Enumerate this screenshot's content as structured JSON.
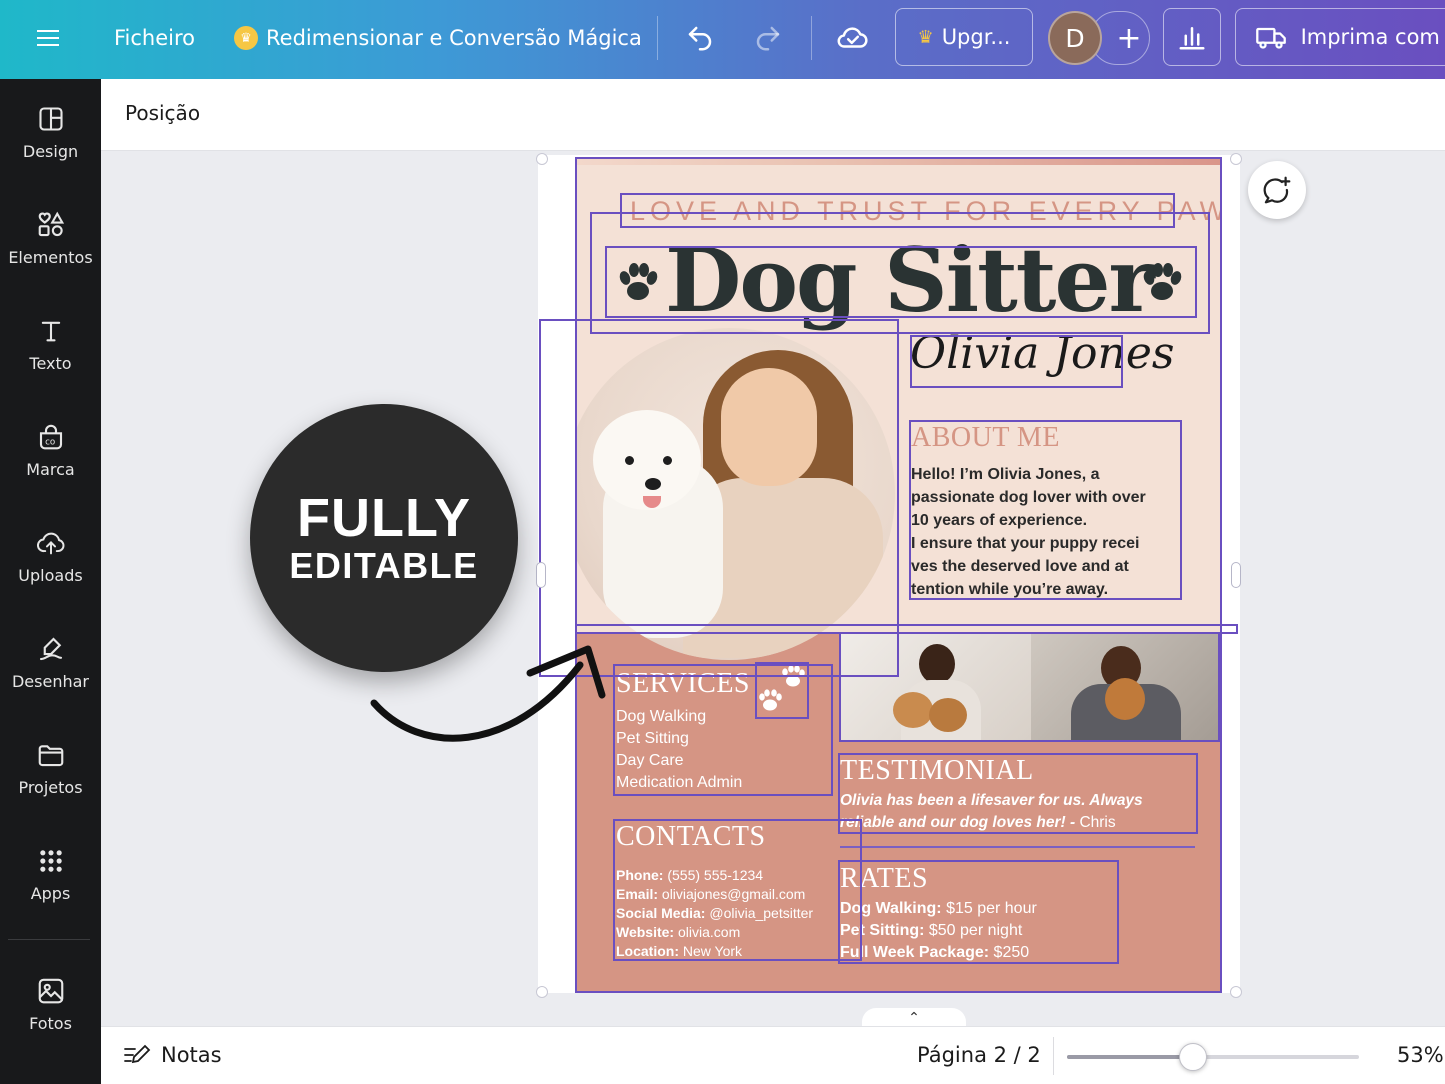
{
  "topbar": {
    "file_label": "Ficheiro",
    "magic_label": "Redimensionar e Conversão Mágica",
    "upgrade_label": "Upgr...",
    "avatar_initial": "D",
    "print_label": "Imprima com o",
    "icons": [
      "menu-icon",
      "crown-icon",
      "undo-icon",
      "redo-icon",
      "cloud-check-icon",
      "crown-icon",
      "plus-icon",
      "bar-chart-icon",
      "truck-icon"
    ]
  },
  "sidebar": {
    "items": [
      {
        "label": "Design",
        "icon": "layout-icon"
      },
      {
        "label": "Elementos",
        "icon": "shapes-icon"
      },
      {
        "label": "Texto",
        "icon": "text-icon"
      },
      {
        "label": "Marca",
        "icon": "brand-icon"
      },
      {
        "label": "Uploads",
        "icon": "cloud-upload-icon"
      },
      {
        "label": "Desenhar",
        "icon": "draw-icon"
      },
      {
        "label": "Projetos",
        "icon": "folder-icon"
      },
      {
        "label": "Apps",
        "icon": "apps-grid-icon"
      },
      {
        "label": "Fotos",
        "icon": "photo-icon"
      }
    ]
  },
  "context_bar": {
    "position_label": "Posição"
  },
  "design": {
    "tagline": "LOVE AND TRUST FOR EVERY PAW",
    "title": "Dog Sitter",
    "name": "Olivia Jones",
    "about_heading": "ABOUT ME",
    "about_lines": [
      "Hello! I’m Olivia Jones, a",
      "passionate dog lover with over",
      "10 years of experience.",
      "I ensure that your puppy recei",
      "ves the deserved love and at",
      "tention while you’re away."
    ],
    "services_heading": "SERVICES",
    "services": [
      "Dog Walking",
      "Pet Sitting",
      "Day Care",
      "Medication Admin"
    ],
    "testimonial_heading": "TESTIMONIAL",
    "testimonial_quote_1": "Olivia has been a lifesaver for us. Always",
    "testimonial_quote_2": "reliable and our dog loves her! - ",
    "testimonial_author": "Chris",
    "contacts_heading": "CONTACTS",
    "contacts": [
      {
        "label": "Phone:",
        "value": " (555) 555-1234"
      },
      {
        "label": "Email:",
        "value": " oliviajones@gmail.com"
      },
      {
        "label": "Social Media:",
        "value": " @olivia_petsitter"
      },
      {
        "label": "Website:",
        "value": " olivia.com"
      },
      {
        "label": "Location:",
        "value": " New York"
      }
    ],
    "rates_heading": "RATES",
    "rates": [
      {
        "label": "Dog Walking:",
        "value": " $15 per hour"
      },
      {
        "label": "Pet Sitting:",
        "value": " $50 per night"
      },
      {
        "label": "Full Week Package:",
        "value": " $250"
      }
    ],
    "colors": {
      "background": "#f4e1d6",
      "accent": "#d59584",
      "title": "#2a3333",
      "selection": "#6a4fc0"
    }
  },
  "badge": {
    "line1": "FULLY",
    "line2": "EDITABLE"
  },
  "bottombar": {
    "notes_label": "Notas",
    "page_indicator": "Página 2 / 2",
    "zoom_label": "53%",
    "zoom_fraction": 0.43
  }
}
